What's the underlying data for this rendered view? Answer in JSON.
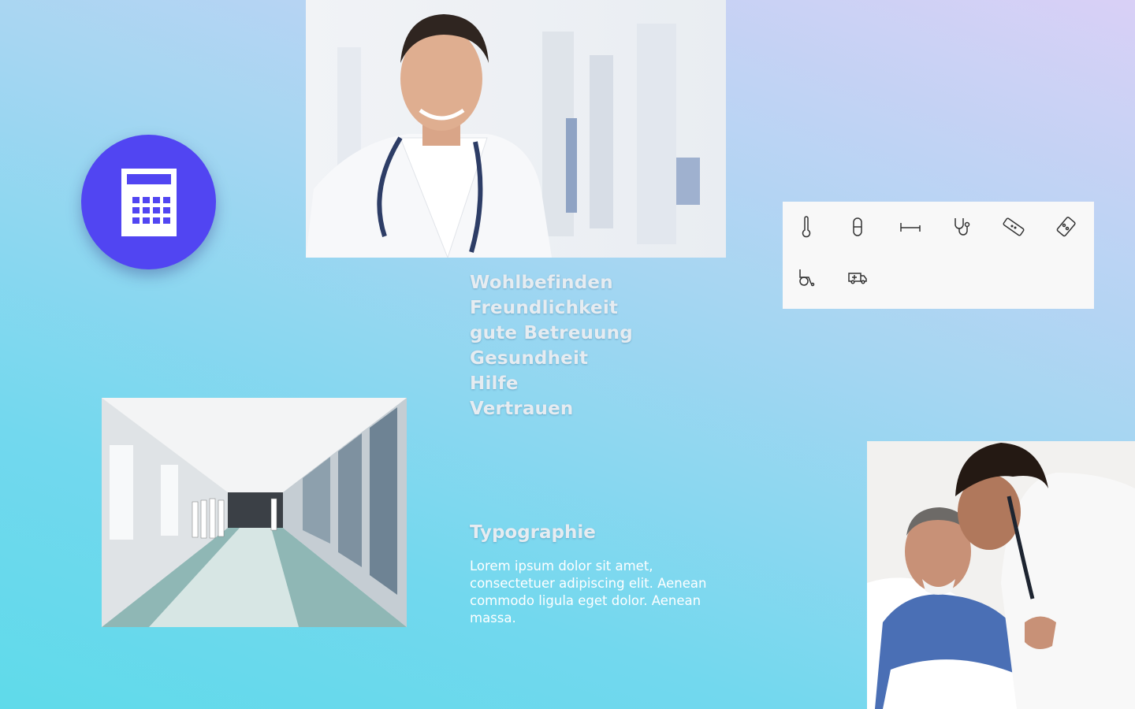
{
  "keywords": [
    "Wohlbefinden",
    "Freundlichkeit",
    "gute Betreuung",
    "Gesundheit",
    "Hilfe",
    "Vertrauen"
  ],
  "typography": {
    "heading": "Typographie",
    "body": "Lorem ipsum dolor sit amet, consectetuer adipiscing elit. Aenean commodo ligula eget dolor. Aenean massa."
  },
  "icons": [
    "thermometer-icon",
    "capsule-icon",
    "bed-icon",
    "stethoscope-icon",
    "bandage-icon",
    "pill-blister-icon",
    "wheelchair-icon",
    "ambulance-icon"
  ],
  "badge_icon": "calculator-icon",
  "colors": {
    "badge": "#5145f2",
    "gradient_top": "#d9d0f6",
    "gradient_bottom": "#5fdaea",
    "icon_panel": "#f8f8f8",
    "icon_stroke": "#333333"
  }
}
